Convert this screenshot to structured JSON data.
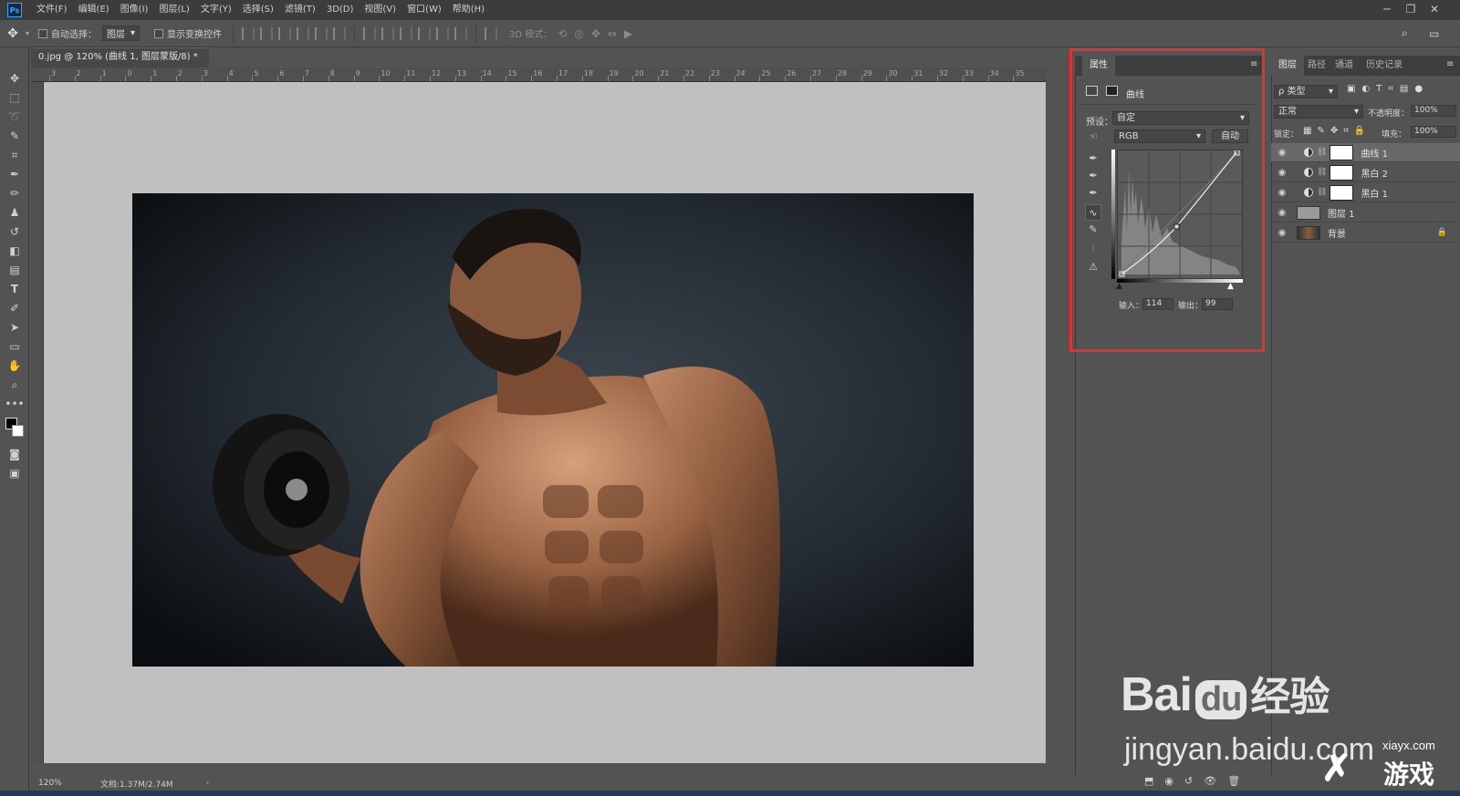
{
  "app": {
    "logo": "Ps",
    "menu": [
      "文件(F)",
      "编辑(E)",
      "图像(I)",
      "图层(L)",
      "文字(Y)",
      "选择(S)",
      "滤镜(T)",
      "3D(D)",
      "视图(V)",
      "窗口(W)",
      "帮助(H)"
    ]
  },
  "options": {
    "auto_select_label": "自动选择：",
    "auto_select_value": "图层",
    "show_transform_label": "显示变换控件",
    "mode_3d_label": "3D 模式："
  },
  "document": {
    "tab_title": "0.jpg @ 120% (曲线 1, 图层蒙版/8) *",
    "zoom": "120%",
    "doc_info": "文档:1.37M/2.74M",
    "ruler_top_ticks": [
      "3",
      "2",
      "1",
      "0",
      "1",
      "2",
      "3",
      "4",
      "5",
      "6",
      "7",
      "8",
      "9",
      "10",
      "11",
      "12",
      "13",
      "14",
      "15",
      "16",
      "17",
      "18",
      "19",
      "20",
      "21",
      "22",
      "23",
      "24",
      "25",
      "26",
      "27",
      "28",
      "29",
      "30",
      "31",
      "32",
      "33",
      "34",
      "35"
    ]
  },
  "properties": {
    "tab_label": "属性",
    "type_label": "曲线",
    "preset_label": "预设：",
    "preset_value": "自定",
    "channel_value": "RGB",
    "auto_button": "自动",
    "input_label": "输入：",
    "input_value": "114",
    "output_label": "输出：",
    "output_value": "99"
  },
  "layers": {
    "tabs": [
      "图层",
      "路径",
      "通道",
      "历史记录"
    ],
    "filter_kind": "ρ 类型",
    "blend_mode": "正常",
    "opacity_label": "不透明度：",
    "opacity_value": "100%",
    "lock_label": "锁定：",
    "fill_label": "填充：",
    "fill_value": "100%",
    "items": [
      {
        "name": "曲线 1"
      },
      {
        "name": "黑白 2"
      },
      {
        "name": "黑白 1"
      },
      {
        "name": "图层 1"
      },
      {
        "name": "背景"
      }
    ]
  },
  "watermarks": {
    "baidu_logo": "Bai",
    "baidu_du": "du",
    "baidu_jy": "经验",
    "baidu_url": "jingyan.baidu.com",
    "xiayx_url": "xiayx.com",
    "xiayx_name": "游戏"
  },
  "colors": {
    "highlight": "#e53030",
    "panel_bg": "#535353",
    "canvas_bg": "#c0c0c0"
  }
}
